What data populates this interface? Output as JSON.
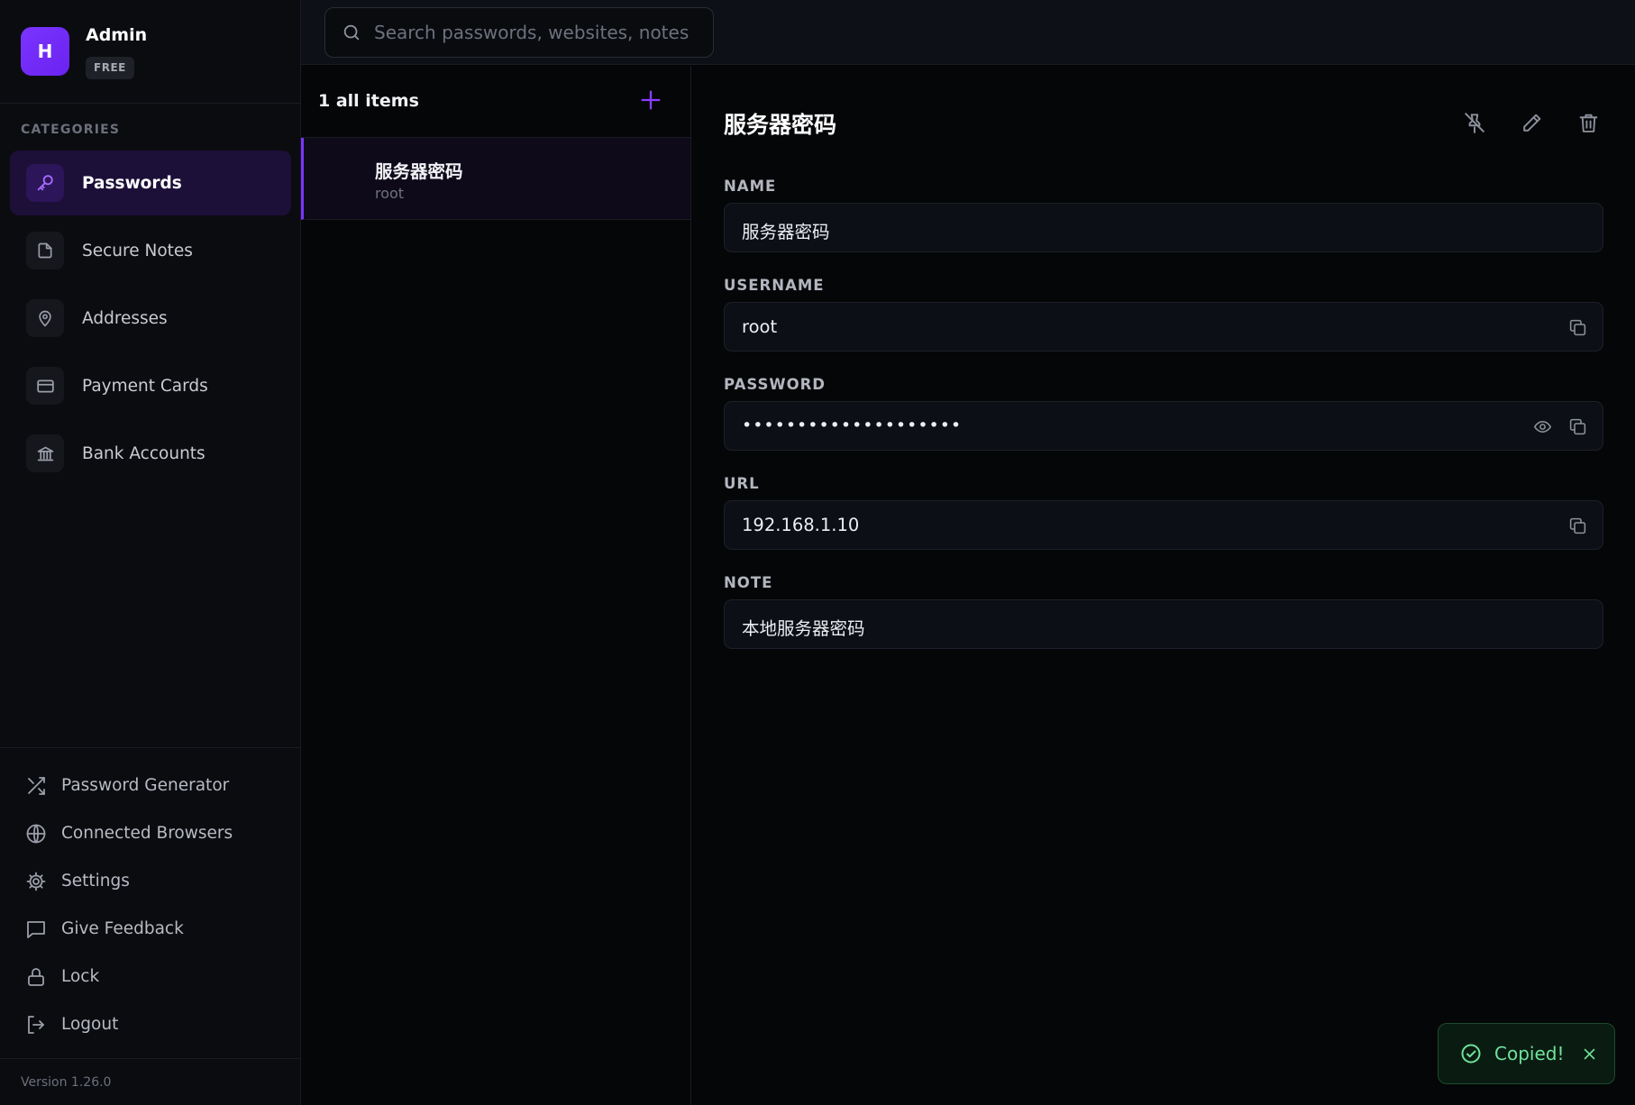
{
  "profile": {
    "initial": "H",
    "name": "Admin",
    "plan": "FREE"
  },
  "sidebar": {
    "heading": "CATEGORIES",
    "categories": [
      {
        "label": "Passwords",
        "icon": "key-icon",
        "active": true
      },
      {
        "label": "Secure Notes",
        "icon": "note-icon",
        "active": false
      },
      {
        "label": "Addresses",
        "icon": "map-pin-icon",
        "active": false
      },
      {
        "label": "Payment Cards",
        "icon": "credit-card-icon",
        "active": false
      },
      {
        "label": "Bank Accounts",
        "icon": "bank-icon",
        "active": false
      }
    ],
    "nav": [
      {
        "label": "Password Generator",
        "icon": "shuffle-icon"
      },
      {
        "label": "Connected Browsers",
        "icon": "globe-icon"
      },
      {
        "label": "Settings",
        "icon": "gear-icon"
      },
      {
        "label": "Give Feedback",
        "icon": "message-icon"
      },
      {
        "label": "Lock",
        "icon": "lock-icon"
      },
      {
        "label": "Logout",
        "icon": "logout-icon"
      }
    ],
    "version": "Version 1.26.0"
  },
  "search": {
    "placeholder": "Search passwords, websites, notes",
    "value": ""
  },
  "list": {
    "count_label": "1 all items",
    "items": [
      {
        "title": "服务器密码",
        "subtitle": "root"
      }
    ]
  },
  "detail": {
    "title": "服务器密码",
    "fields": {
      "name": {
        "label": "NAME",
        "value": "服务器密码"
      },
      "username": {
        "label": "USERNAME",
        "value": "root"
      },
      "password": {
        "label": "PASSWORD",
        "value": "••••••••••••••••••••"
      },
      "url": {
        "label": "URL",
        "value": "192.168.1.10"
      },
      "note": {
        "label": "NOTE",
        "value": "本地服务器密码"
      }
    }
  },
  "toast": {
    "text": "Copied!"
  },
  "colors": {
    "accent": "#7b35ff",
    "success": "#6fe39a",
    "background": "#050608",
    "sidebar": "#0b0c10"
  }
}
